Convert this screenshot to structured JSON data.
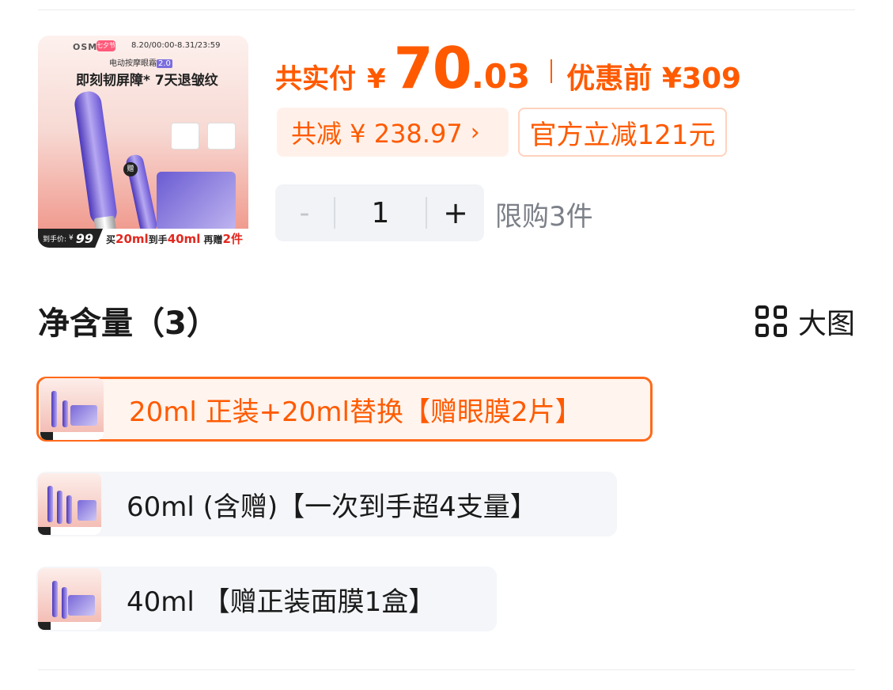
{
  "product_image": {
    "brand": "OSM",
    "festival_badge": "七夕节",
    "promo_date": "8.20/00:00-8.31/23:59",
    "subtitle_prefix": "电动按摩眼霜",
    "subtitle_version": "2.0",
    "headline": "即刻韧屏障* 7天退皱纹",
    "gift_badge": "赠",
    "price_label": "到手价:",
    "price_prefix": "¥",
    "price_value": "99",
    "promo_parts": [
      "买",
      "20ml",
      "到手",
      "40ml",
      " 再赠",
      "2件"
    ]
  },
  "price": {
    "label": "共实付",
    "currency": "¥",
    "integer": "70",
    "decimal": ".03",
    "original_label": "优惠前",
    "original_price": "¥309"
  },
  "discounts": {
    "total": "共减 ¥ 238.97",
    "total_chevron": "›",
    "official": "官方立减121元"
  },
  "quantity": {
    "minus": "-",
    "value": "1",
    "plus": "+",
    "limit": "限购3件"
  },
  "spec_section": {
    "title": "净含量（3）",
    "view_toggle": "大图"
  },
  "options": [
    {
      "label": "20ml 正装+20ml替换【赠眼膜2片】",
      "selected": true
    },
    {
      "label": "60ml (含赠)【一次到手超4支量】",
      "selected": false
    },
    {
      "label": "40ml 【赠正装面膜1盒】",
      "selected": false
    }
  ],
  "colors": {
    "accent": "#ff5a00",
    "selected_border": "#ff6a1a",
    "selected_bg": "#fff4ee",
    "option_bg": "#f4f6f9",
    "muted_text": "#7c8088"
  }
}
